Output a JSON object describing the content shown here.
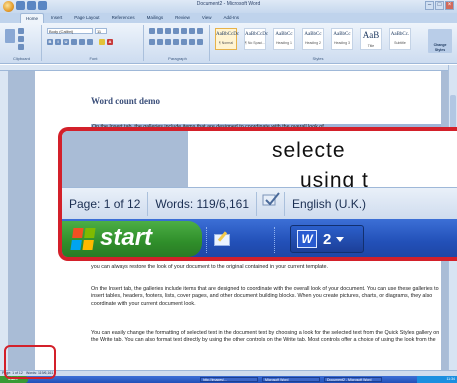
{
  "app": {
    "window_title": "Document2 - Microsoft Word"
  },
  "ribbon": {
    "tabs": [
      "Home",
      "Insert",
      "Page Layout",
      "References",
      "Mailings",
      "Review",
      "View",
      "Add-Ins"
    ],
    "active_tab": "Home",
    "font_name": "Body (Calibri)",
    "font_size": "11",
    "groups": [
      "Clipboard",
      "Font",
      "Paragraph",
      "Styles"
    ],
    "styles": [
      {
        "sample": "AaBbCcDc",
        "name": "¶ Normal"
      },
      {
        "sample": "AaBbCcDc",
        "name": "¶ No Spaci..."
      },
      {
        "sample": "AaBbCc",
        "name": "Heading 1"
      },
      {
        "sample": "AaBbCc",
        "name": "Heading 2"
      },
      {
        "sample": "AaBbCc",
        "name": "Heading 3"
      },
      {
        "sample": "AaB",
        "name": "Title"
      },
      {
        "sample": "AaBbCc.",
        "name": "Subtitle"
      }
    ],
    "change_styles": "Change Styles"
  },
  "document": {
    "title": "Word count demo",
    "first_line": "On the Insert tab, the galleries include items that are designed to coordinate with the overall look of",
    "paragraphs": [
      "you can always restore the look of your document to the original contained in your current template.",
      "On the Insert tab, the galleries include items that are designed to coordinate with the overall look of your document. You can use these galleries to insert tables, headers, footers, lists, cover pages, and other document building blocks. When you create pictures, charts, or diagrams, they also coordinate with your current document look.",
      "You can easily change the formatting of selected text in the document text by choosing a look for the selected text from the Quick Styles gallery on the Write tab. You can also format text directly by using the other controls on the Write tab. Most controls offer a choice of using the look from the"
    ]
  },
  "zoom": {
    "doc_text_1": "selecte",
    "doc_text_2": "using t",
    "status_page": "Page: 1 of 12",
    "status_words": "Words: 119/6,161",
    "proofing_icon": "spelling-check-icon",
    "status_language": "English (U.K.)",
    "start_label": "start",
    "word_button_count": "2"
  },
  "statusbar": {
    "page": "Page: 1 of 12",
    "words": "Words: 119/6,161"
  },
  "taskbar": {
    "start_label": "start",
    "items": [
      "Microsoft Word",
      "Document2 - Microsoft Word",
      "http://images/..."
    ],
    "clock": "11:34"
  },
  "colors": {
    "callout_red": "#d3202a",
    "start_green": "#3a9a35",
    "taskbar_blue": "#2250b8"
  }
}
